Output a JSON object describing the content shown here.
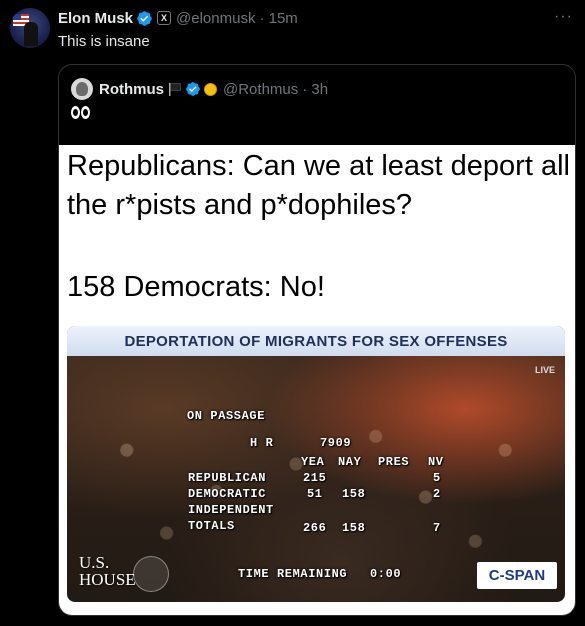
{
  "tweet": {
    "author_name": "Elon Musk",
    "handle": "@elonmusk",
    "time": "· 15m",
    "text": "This is insane",
    "badge_icon": "x-affiliate-badge",
    "verified_color": "#1d9bf0"
  },
  "quoted": {
    "author_name": "Rothmus",
    "handle": "@Rothmus",
    "time": "· 3h",
    "text_emoji": "eyes-emoji",
    "icons": [
      "black-flag-icon",
      "verified-icon",
      "coin-emoji"
    ],
    "image": {
      "caption_line1": "Republicans: Can we at least deport all the r*pists and p*dophiles?",
      "caption_line2": "158 Democrats: No!",
      "tv": {
        "banner": "DEPORTATION OF MIGRANTS FOR SEX OFFENSES",
        "live": "LIVE",
        "on_passage": "ON PASSAGE",
        "hr": "H R",
        "bill": "7909",
        "cols": {
          "yea": "YEA",
          "nay": "NAY",
          "pres": "PRES",
          "nv": "NV"
        },
        "rows": [
          {
            "label": "REPUBLICAN",
            "yea": "215",
            "nay": "",
            "pres": "",
            "nv": "5"
          },
          {
            "label": "DEMOCRATIC",
            "yea": "51",
            "nay": "158",
            "pres": "",
            "nv": "2"
          },
          {
            "label": "INDEPENDENT",
            "yea": "",
            "nay": "",
            "pres": "",
            "nv": ""
          },
          {
            "label": "TOTALS",
            "yea": "266",
            "nay": "158",
            "pres": "",
            "nv": "7"
          }
        ],
        "time_label": "TIME REMAINING",
        "time_value": "0:00",
        "logo_line1": "U.S.",
        "logo_line2": "HOUSE",
        "network": "C-SPAN"
      }
    }
  },
  "more_icon": "more-dots-icon"
}
